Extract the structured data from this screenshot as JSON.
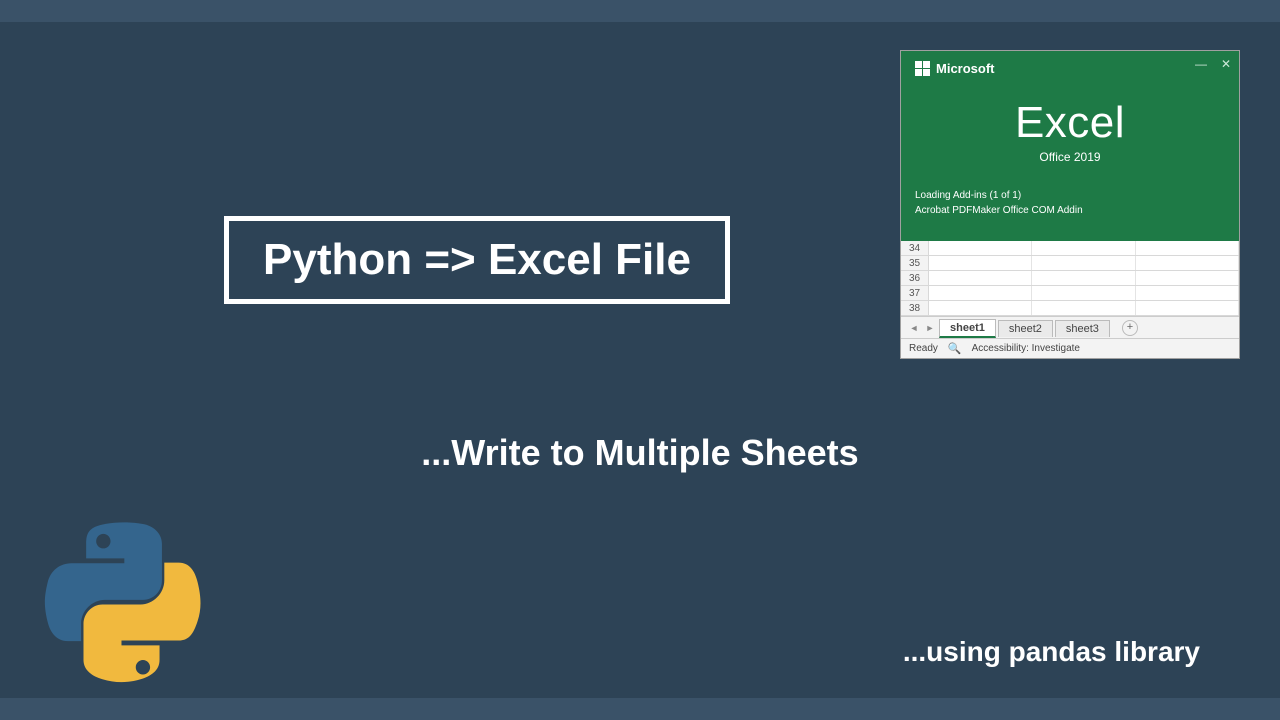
{
  "title": "Python => Excel File",
  "subtitle": "...Write to Multiple Sheets",
  "footer": "...using pandas library",
  "excel": {
    "brand": "Microsoft",
    "product": "Excel",
    "version": "Office 2019",
    "loading_line1": "Loading Add-ins (1 of 1)",
    "loading_line2": "Acrobat PDFMaker Office COM Addin",
    "rows": [
      "34",
      "35",
      "36",
      "37",
      "38"
    ],
    "tabs": [
      "sheet1",
      "sheet2",
      "sheet3"
    ],
    "active_tab_index": 0,
    "status_ready": "Ready",
    "status_accessibility": "Accessibility: Investigate"
  }
}
